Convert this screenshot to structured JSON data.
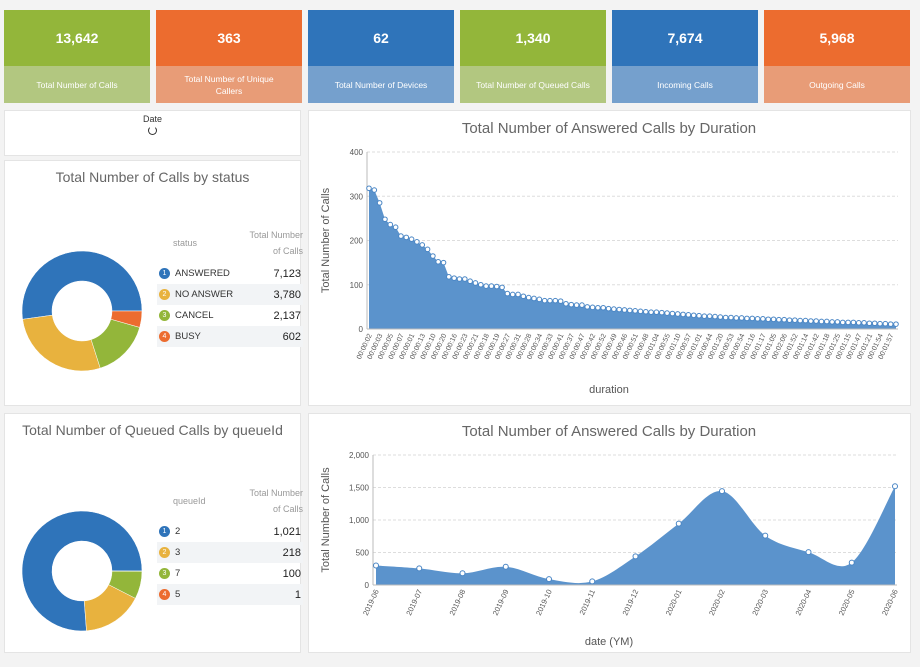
{
  "kpis": [
    {
      "value": "13,642",
      "label": "Total Number of Calls",
      "top": "#93b63a",
      "bottom": "#b2c780"
    },
    {
      "value": "363",
      "label": "Total Number of Unique Callers",
      "top": "#ec6c2f",
      "bottom": "#e89c77"
    },
    {
      "value": "62",
      "label": "Total Number of Devices",
      "top": "#2f74ba",
      "bottom": "#75a0cd"
    },
    {
      "value": "1,340",
      "label": "Total Number of Queued Calls",
      "top": "#93b63a",
      "bottom": "#b2c780"
    },
    {
      "value": "7,674",
      "label": "Incoming Calls",
      "top": "#2f74ba",
      "bottom": "#75a0cd"
    },
    {
      "value": "5,968",
      "label": "Outgoing Calls",
      "top": "#ec6c2f",
      "bottom": "#e89c77"
    }
  ],
  "date_filter": {
    "label": "Date",
    "icon": "loading-spinner-icon"
  },
  "status_panel": {
    "title": "Total Number of Calls by status",
    "col1": "status",
    "col2": "Total Number of Calls",
    "items": [
      {
        "label": "ANSWERED",
        "value": "7,123",
        "n": 7123,
        "color": "#2f74ba"
      },
      {
        "label": "NO ANSWER",
        "value": "3,780",
        "n": 3780,
        "color": "#e8b23e"
      },
      {
        "label": "CANCEL",
        "value": "2,137",
        "n": 2137,
        "color": "#93b63a"
      },
      {
        "label": "BUSY",
        "value": "602",
        "n": 602,
        "color": "#ec6c2f"
      }
    ]
  },
  "queue_panel": {
    "title": "Total Number of Queued Calls by queueId",
    "col1": "queueId",
    "col2": "Total Number of Calls",
    "items": [
      {
        "label": "2",
        "value": "1,021",
        "n": 1021,
        "color": "#2f74ba"
      },
      {
        "label": "3",
        "value": "218",
        "n": 218,
        "color": "#e8b23e"
      },
      {
        "label": "7",
        "value": "100",
        "n": 100,
        "color": "#93b63a"
      },
      {
        "label": "5",
        "value": "1",
        "n": 1,
        "color": "#ec6c2f"
      }
    ]
  },
  "chart_data": [
    {
      "type": "area",
      "title": "Total Number of Answered Calls by Duration",
      "xlabel": "duration",
      "ylabel": "Total Number of Calls",
      "ylim": [
        0,
        400
      ],
      "yticks": [
        "0",
        "100",
        "200",
        "300",
        "400"
      ],
      "grid": true,
      "color": "#5b93cc",
      "x_tick_labels": [
        "00:00:02",
        "00:00:03",
        "00:00:05",
        "00:00:07",
        "00:00:01",
        "00:00:13",
        "00:00:10",
        "00:00:20",
        "00:00:16",
        "00:00:23",
        "00:00:21",
        "00:00:18",
        "00:00:19",
        "00:00:27",
        "00:00:31",
        "00:00:28",
        "00:00:34",
        "00:00:33",
        "00:00:41",
        "00:00:37",
        "00:00:47",
        "00:00:42",
        "00:00:52",
        "00:00:49",
        "00:00:46",
        "00:00:51",
        "00:00:48",
        "00:01:04",
        "00:00:55",
        "00:01:10",
        "00:00:57",
        "00:01:01",
        "00:00:44",
        "00:01:20",
        "00:00:53",
        "00:00:54",
        "00:01:16",
        "00:01:17",
        "00:01:05",
        "00:02:06",
        "00:01:52",
        "00:01:14",
        "00:01:42",
        "00:01:18",
        "00:01:25",
        "00:01:15",
        "00:01:47",
        "00:01:21",
        "00:01:54",
        "00:01:57"
      ],
      "values": [
        318,
        314,
        285,
        248,
        236,
        230,
        210,
        207,
        203,
        197,
        190,
        180,
        165,
        152,
        150,
        118,
        115,
        113,
        113,
        108,
        104,
        100,
        97,
        97,
        96,
        94,
        80,
        78,
        78,
        74,
        71,
        69,
        67,
        64,
        64,
        64,
        63,
        57,
        55,
        54,
        54,
        50,
        49,
        48,
        48,
        46,
        45,
        44,
        43,
        42,
        41,
        40,
        39,
        38,
        38,
        37,
        36,
        35,
        34,
        33,
        32,
        31,
        30,
        29,
        29,
        28,
        27,
        26,
        26,
        25,
        25,
        24,
        24,
        23,
        23,
        22,
        22,
        21,
        21,
        20,
        20,
        19,
        19,
        18,
        18,
        17,
        17,
        16,
        16,
        15,
        15,
        15,
        14,
        14,
        13,
        13,
        12,
        12,
        11,
        11
      ]
    },
    {
      "type": "area",
      "title": "Total Number of Answered Calls by Duration",
      "xlabel": "date (YM)",
      "ylabel": "Total Number of Calls",
      "ylim": [
        0,
        2000
      ],
      "yticks": [
        "0",
        "500",
        "1,000",
        "1,500",
        "2,000"
      ],
      "grid": true,
      "color": "#5b93cc",
      "categories": [
        "2019-06",
        "2019-07",
        "2019-08",
        "2019-09",
        "2019-10",
        "2019-11",
        "2019-12",
        "2020-01",
        "2020-02",
        "2020-03",
        "2020-04",
        "2020-05",
        "2020-06"
      ],
      "values": [
        300,
        255,
        180,
        280,
        90,
        55,
        440,
        945,
        1445,
        760,
        505,
        345,
        1520
      ]
    }
  ]
}
